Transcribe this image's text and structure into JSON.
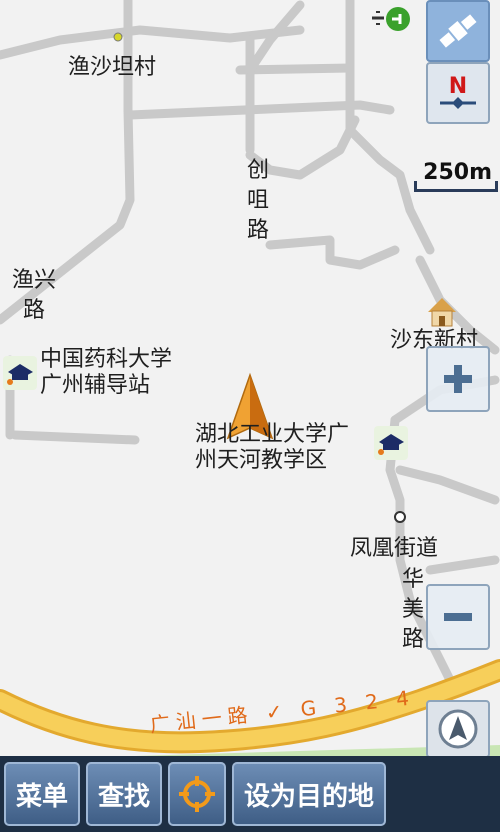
{
  "map": {
    "labels": {
      "yushatan": "渔沙坦村",
      "chuangju_road": "创咀路",
      "yuxing_road": "渔兴路",
      "pharma_univ": [
        "中国药科大学",
        "广州辅导站"
      ],
      "shadong_village": "沙东新村",
      "hubei_univ": [
        "湖北工业大学广",
        "州天河教学区"
      ],
      "fenghuang_street": "凤凰街道",
      "huamei_road": "华美路",
      "guangshan_road": "广汕一路 ✓ G 3 2 4"
    },
    "scale": "250m"
  },
  "controls": {
    "gps_icon": "satellite-icon",
    "compass_icon": "north-icon",
    "zoom_in_icon": "plus-icon",
    "zoom_out_icon": "minus-icon",
    "locate_icon": "navigation-arrow-icon"
  },
  "toolbar": {
    "menu": "菜单",
    "search": "查找",
    "set_destination": "设为目的地"
  },
  "colors": {
    "road_major": "#f5c242",
    "road_minor": "#c9c9c9",
    "park": "#c9e6b4",
    "toolbar_bg": "#1e2f44",
    "cursor": "#e58a12"
  }
}
